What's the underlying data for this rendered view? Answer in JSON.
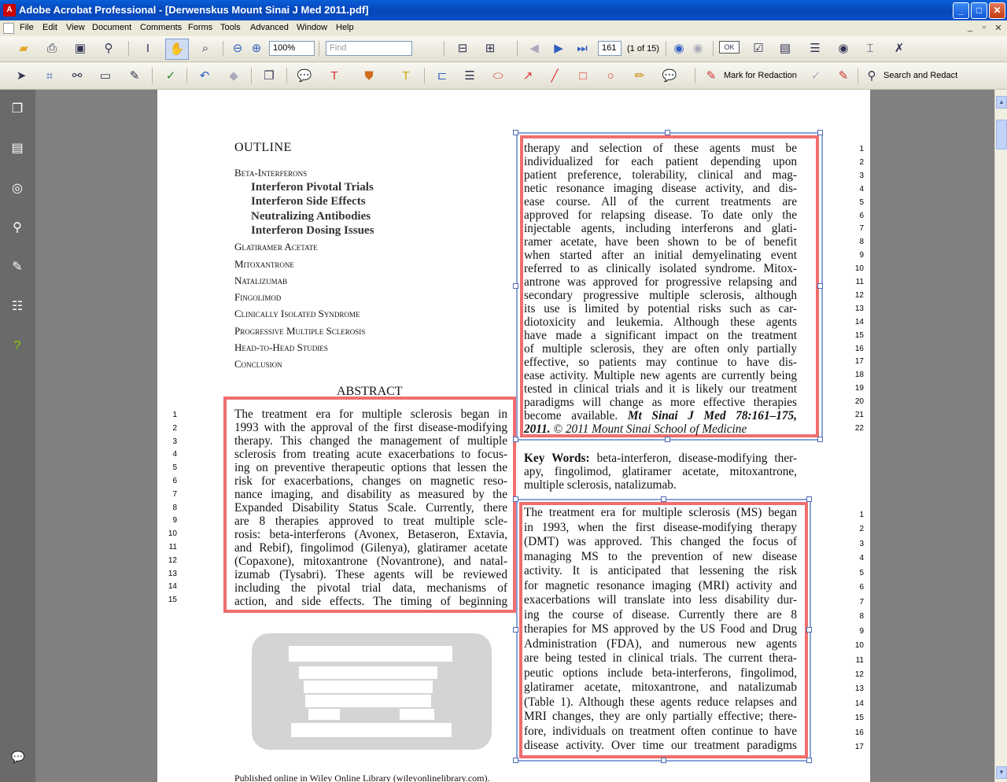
{
  "window": {
    "title": "Adobe Acrobat Professional - [Derwenskus Mount Sinai J Med 2011.pdf]",
    "minimize": "_",
    "maximize": "□",
    "close": "✕"
  },
  "menu": [
    "File",
    "Edit",
    "View",
    "Document",
    "Comments",
    "Forms",
    "Tools",
    "Advanced",
    "Window",
    "Help"
  ],
  "toolbar1": {
    "zoom": "100%",
    "find_placeholder": "Find",
    "page_number": "161",
    "page_of": "(1 of 15)",
    "ok_label": "OK"
  },
  "toolbar2": {
    "mark_for_redaction": "Mark for Redaction",
    "search_and_redact": "Search and Redact"
  },
  "document": {
    "outline_title": "OUTLINE",
    "outline": [
      {
        "text": "Beta-Interferons",
        "level": 1
      },
      {
        "text": "Interferon Pivotal Trials",
        "level": 2
      },
      {
        "text": "Interferon Side Effects",
        "level": 2
      },
      {
        "text": "Neutralizing Antibodies",
        "level": 2
      },
      {
        "text": "Interferon Dosing Issues",
        "level": 2
      },
      {
        "text": "Glatiramer Acetate",
        "level": 1
      },
      {
        "text": "Mitoxantrone",
        "level": 1
      },
      {
        "text": "Natalizumab",
        "level": 1
      },
      {
        "text": "Fingolimod",
        "level": 1
      },
      {
        "text": "Clinically Isolated Syndrome",
        "level": 1
      },
      {
        "text": "Progressive Multiple Sclerosis",
        "level": 1
      },
      {
        "text": "Head-to-Head Studies",
        "level": 1
      },
      {
        "text": "Conclusion",
        "level": 1
      }
    ],
    "abstract_title": "ABSTRACT",
    "abstract_lines": [
      "The treatment era for multiple sclerosis began in",
      "1993 with the approval of the first disease-modifying",
      "therapy. This changed the management of multiple",
      "sclerosis from treating acute exacerbations to focus-",
      "ing on preventive therapeutic options that lessen the",
      "risk for exacerbations, changes on magnetic reso-",
      "nance imaging, and disability as measured by the",
      "Expanded Disability Status Scale. Currently, there",
      "are 8 therapies approved to treat multiple scle-",
      "rosis: beta-interferons (Avonex, Betaseron, Extavia,",
      "and Rebif), fingolimod (Gilenya), glatiramer acetate",
      "(Copaxone), mitoxantrone (Novantrone), and natal-",
      "izumab (Tysabri). These agents will be reviewed",
      "including the pivotal trial data, mechanisms of",
      "action, and side effects. The timing of beginning"
    ],
    "abstract_cont_lines": [
      "therapy and selection of these agents must be",
      "individualized for each patient depending upon",
      "patient preference, tolerability, clinical and mag-",
      "netic resonance imaging disease activity, and dis-",
      "ease course. All of the current treatments are",
      "approved for relapsing disease. To date only the",
      "injectable agents, including interferons and glati-",
      "ramer acetate, have been shown to be of benefit",
      "when started after an initial demyelinating event",
      "referred to as clinically isolated syndrome. Mitox-",
      "antrone was approved for progressive relapsing and",
      "secondary progressive multiple sclerosis, although",
      "its use is limited by potential risks such as car-",
      "diotoxicity and leukemia. Although these agents",
      "have made a significant impact on the treatment",
      "of multiple sclerosis, they are often only partially",
      "effective, so patients may continue to have dis-",
      "ease activity. Multiple new agents are currently being",
      "tested in clinical trials and it is likely our treatment",
      "paradigms will change as more effective therapies",
      "become available."
    ],
    "citation_bold": "Mt Sinai J Med 78:161–175, 2011.",
    "citation_rest": "© 2011 Mount Sinai School of Medicine",
    "keywords_label": "Key Words:",
    "keywords_lines": [
      "beta-interferon, disease-modifying ther-",
      "apy, fingolimod, glatiramer acetate, mitoxantrone,",
      "multiple sclerosis, natalizumab."
    ],
    "intro_lines": [
      "The treatment era for multiple sclerosis (MS) began",
      "in 1993, when the first disease-modifying therapy",
      "(DMT) was approved. This changed the focus of",
      "managing MS to the prevention of new disease",
      "activity. It is anticipated that lessening the risk",
      "for magnetic resonance imaging (MRI) activity and",
      "exacerbations will translate into less disability dur-",
      "ing the course of disease. Currently there are 8",
      "therapies for MS approved by the US Food and Drug",
      "Administration (FDA), and numerous new agents",
      "are being tested in clinical trials. The current thera-",
      "peutic options include beta-interferons, fingolimod,",
      "glatiramer acetate, mitoxantrone, and natalizumab",
      "(Table 1). Although these agents reduce relapses and",
      "MRI changes, they are only partially effective; there-",
      "fore, individuals on treatment often continue to have",
      "disease activity. Over time our treatment paradigms"
    ],
    "footer": "Published online in Wiley Online Library (wileyonlinelibrary.com)."
  }
}
